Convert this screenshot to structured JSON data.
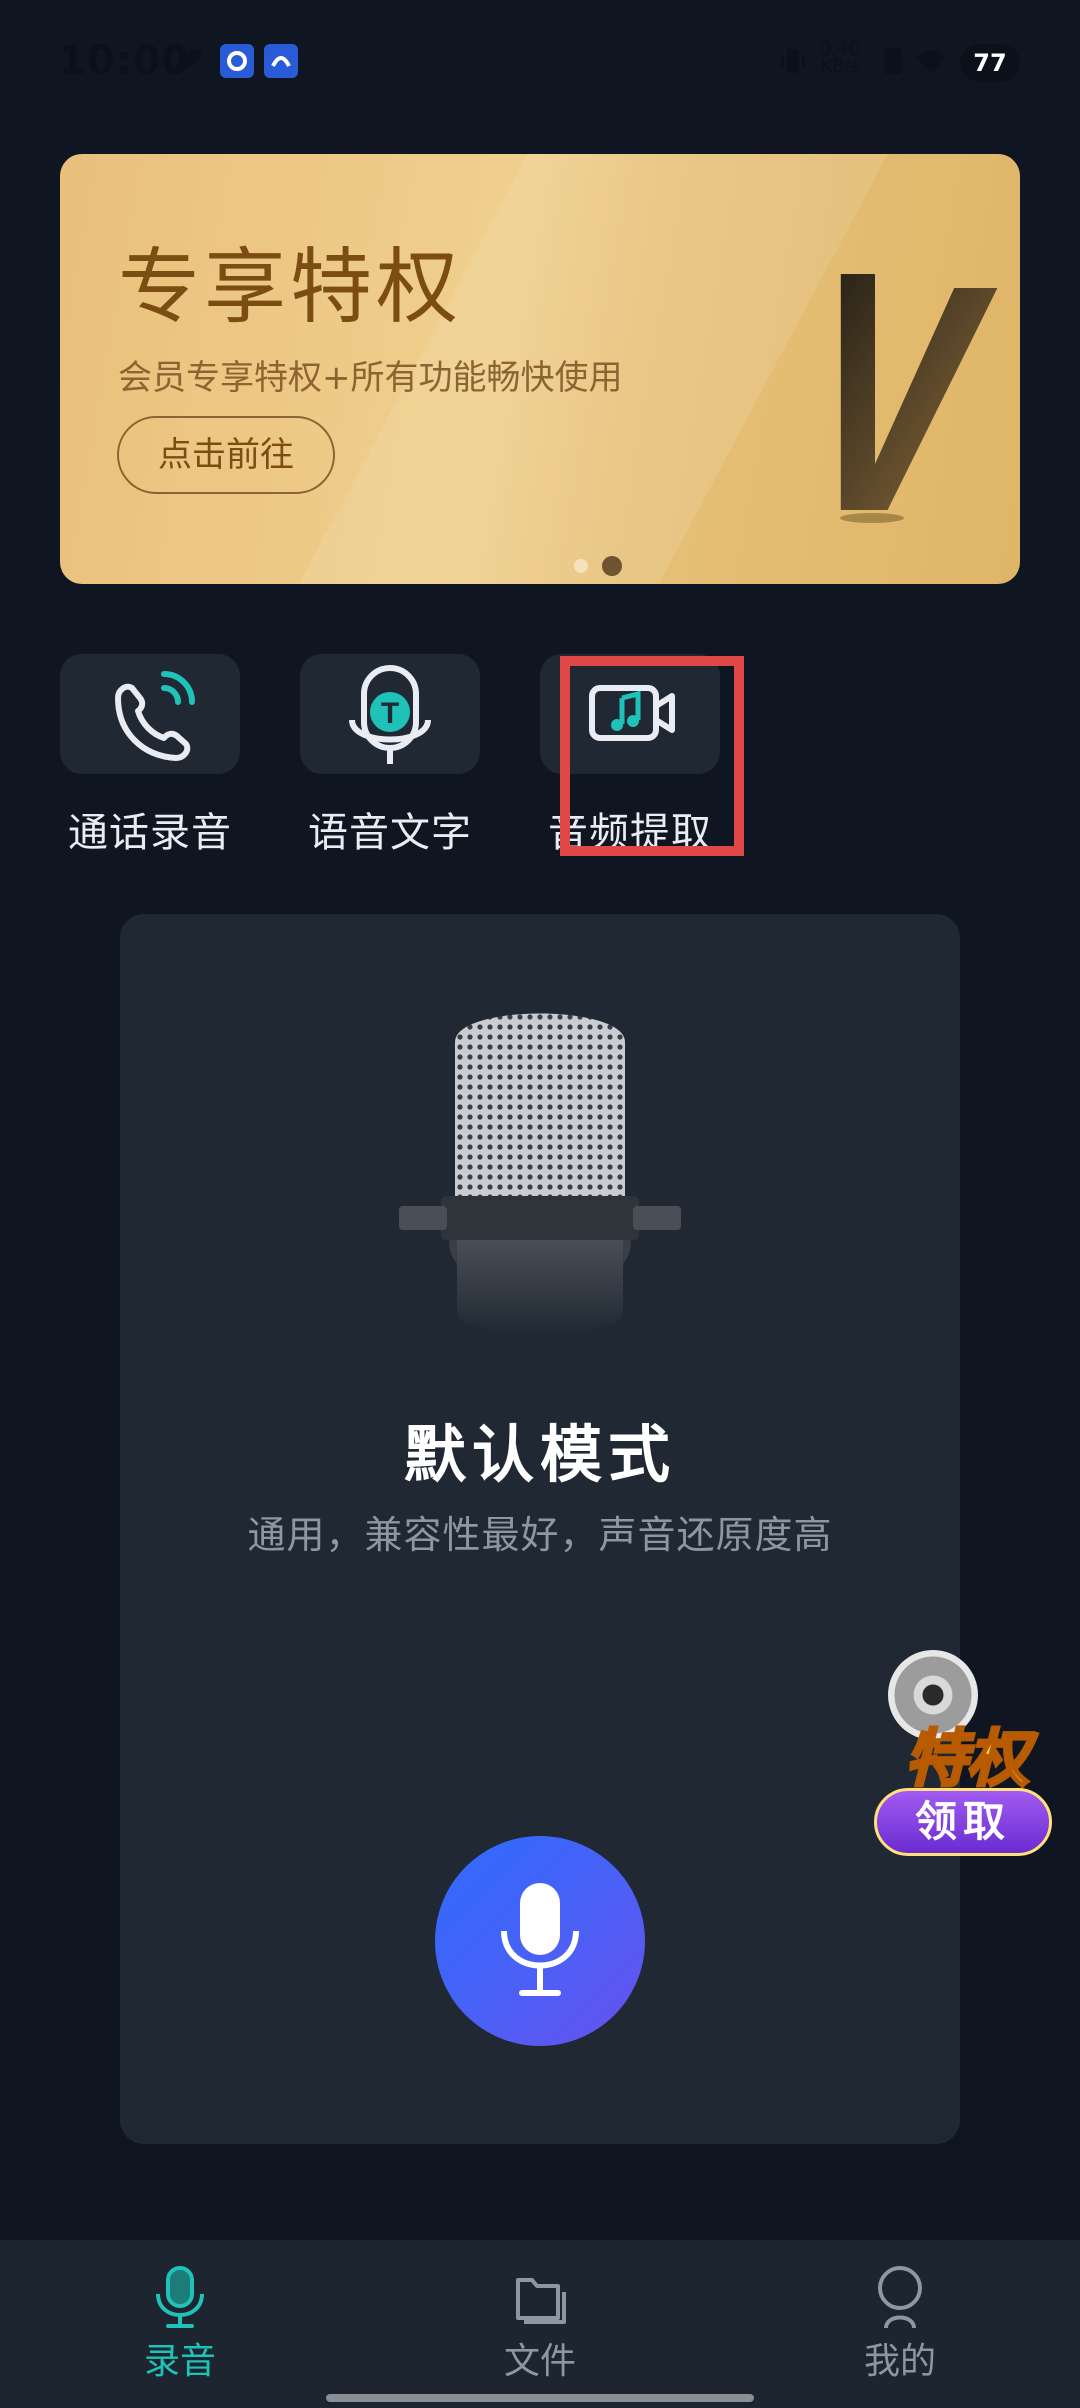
{
  "status_bar": {
    "time": "10:00",
    "net_speed_value": "0.40",
    "net_speed_unit": "KB/s",
    "battery": "77"
  },
  "banner": {
    "title": "专享特权",
    "subtitle": "会员专享特权+所有功能畅快使用",
    "button_label": "点击前往"
  },
  "quick_actions": [
    {
      "label": "通话录音",
      "icon": "phone-call-icon"
    },
    {
      "label": "语音文字",
      "icon": "voice-to-text-icon"
    },
    {
      "label": "音频提取",
      "icon": "video-music-icon"
    }
  ],
  "mode_card": {
    "title": "默认模式",
    "description": "通用，兼容性最好，声音还原度高"
  },
  "promo_badge": {
    "title": "特权",
    "action": "领取"
  },
  "bottom_nav": [
    {
      "label": "录音",
      "icon": "microphone-icon",
      "active": true
    },
    {
      "label": "文件",
      "icon": "folder-icon",
      "active": false
    },
    {
      "label": "我的",
      "icon": "profile-icon",
      "active": false
    }
  ],
  "colors": {
    "background": "#0f1622",
    "card": "#1f2833",
    "accent": "#1fc2b8",
    "record_button": "#3f63f7",
    "banner_gold": "#e9c07b",
    "highlight": "#e04848"
  }
}
